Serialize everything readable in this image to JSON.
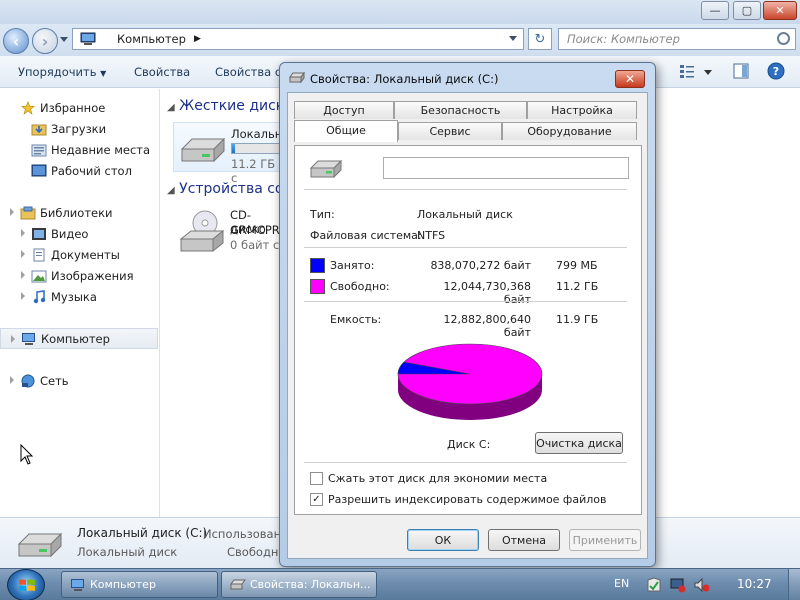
{
  "explorer": {
    "window_buttons": {
      "minimize": "—",
      "maximize": "▢",
      "close": "✕"
    },
    "address": {
      "path": "Компьютер",
      "refresh_glyph": "↻"
    },
    "search": {
      "placeholder": "Поиск: Компьютер"
    },
    "toolbar": {
      "organize": "Упорядочить",
      "properties": "Свойства",
      "system_properties": "Свойства си"
    },
    "nav": {
      "favorites": "Избранное",
      "downloads": "Загрузки",
      "recent": "Недавние места",
      "desktop": "Рабочий стол",
      "libraries": "Библиотеки",
      "video": "Видео",
      "documents": "Документы",
      "images": "Изображения",
      "music": "Музыка",
      "computer": "Компьютер",
      "network": "Сеть"
    },
    "groups": {
      "hard_drives": "Жесткие диски",
      "devices": "Устройства со"
    },
    "drives": {
      "local_name": "Локальн",
      "local_free": "11.2 ГБ с",
      "local_used_fraction": 0.07,
      "cd_name": "CD-диско",
      "cd_label": "GRMCPR",
      "cd_free": "0 байт с"
    },
    "details": {
      "name": "Локальный диск (C:)",
      "type": "Локальный диск",
      "used_label": "Использовано",
      "free_label": "Свободно"
    }
  },
  "dialog": {
    "title": "Свойства: Локальный диск (C:)",
    "close": "✕",
    "tabs_back": [
      "Доступ",
      "Безопасность",
      "Настройка"
    ],
    "tabs_front": [
      "Общие",
      "Сервис",
      "Оборудование"
    ],
    "name_value": "",
    "type_label": "Тип:",
    "type_value": "Локальный диск",
    "fs_label": "Файловая система:",
    "fs_value": "NTFS",
    "used_label": "Занято:",
    "used_bytes": "838,070,272 байт",
    "used_size": "799 МБ",
    "free_label": "Свободно:",
    "free_bytes": "12,044,730,368 байт",
    "free_size": "11.2 ГБ",
    "capacity_label": "Емкость:",
    "capacity_bytes": "12,882,800,640 байт",
    "capacity_size": "11.9 ГБ",
    "disk_label": "Диск С:",
    "cleanup_button": "Очистка диска",
    "compress_label": "Сжать этот диск для экономии места",
    "compress_checked": false,
    "index_label": "Разрешить индексировать содержимое файлов",
    "index_checked": true,
    "ok": "ОК",
    "cancel": "Отмена",
    "apply": "Применить",
    "colors": {
      "used": "#0000ff",
      "free": "#ff00ff"
    }
  },
  "chart_data": {
    "type": "pie",
    "title": "",
    "categories": [
      "Занято",
      "Свободно"
    ],
    "values": [
      838070272,
      12044730368
    ],
    "colors": [
      "#0000ff",
      "#ff00ff"
    ]
  },
  "taskbar": {
    "task1": "Компьютер",
    "task2": "Свойства: Локальн...",
    "lang": "EN",
    "time": "10:27"
  }
}
